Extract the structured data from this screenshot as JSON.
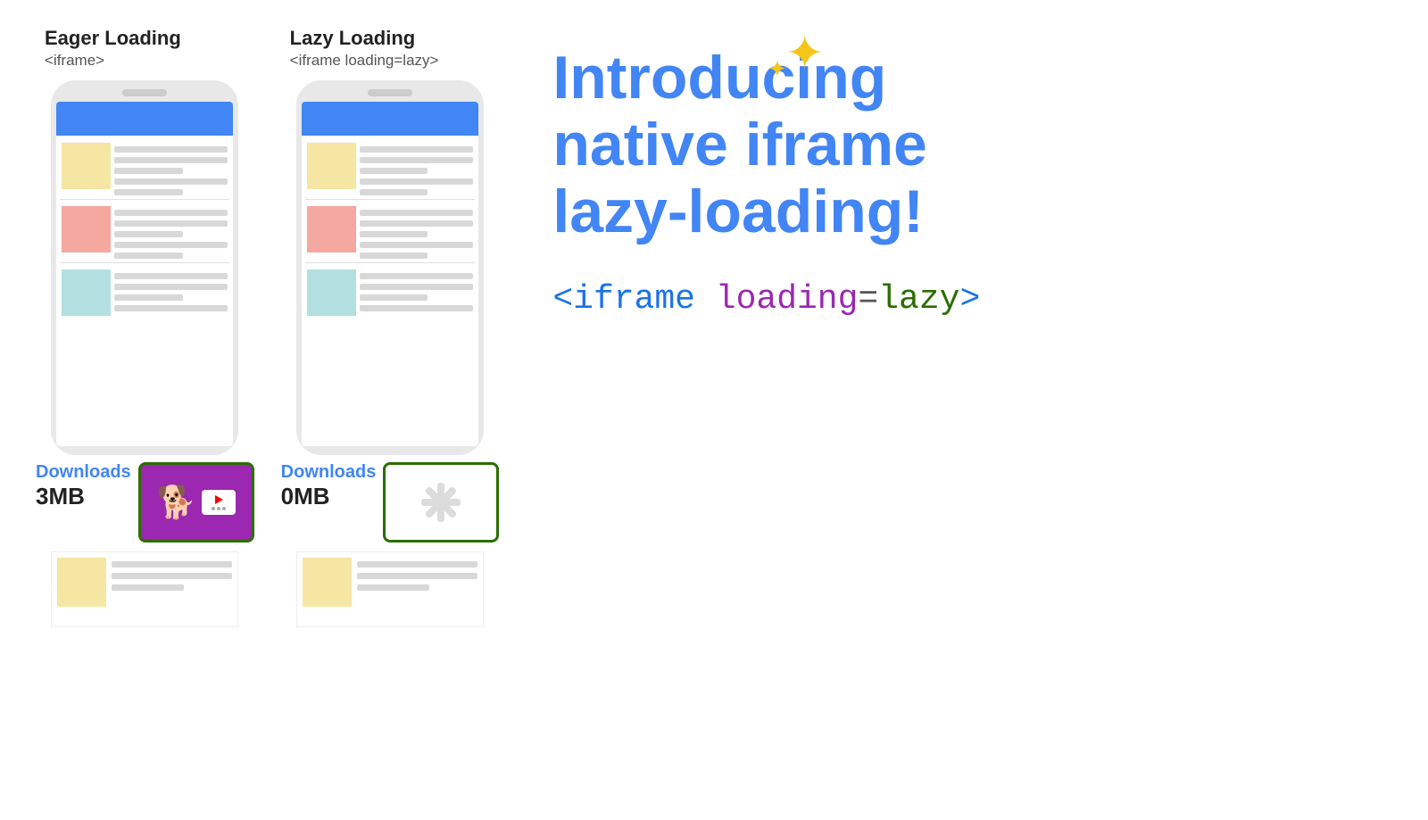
{
  "eager": {
    "label": "Eager Loading",
    "sublabel": "<iframe>",
    "downloads_label": "Downloads",
    "downloads_size": "3MB"
  },
  "lazy": {
    "label": "Lazy Loading",
    "sublabel": "<iframe loading=lazy>",
    "downloads_label": "Downloads",
    "downloads_size": "0MB"
  },
  "intro": {
    "title": "Introducing\nnative iframe\nlazy-loading!",
    "code": "<iframe loading=lazy>"
  },
  "sparkle": {
    "symbol": "✦"
  }
}
